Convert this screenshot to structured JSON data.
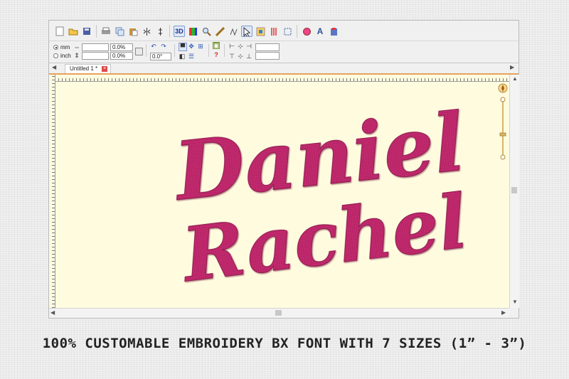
{
  "window": {
    "toolbar_icons": [
      "new-file-icon",
      "open-folder-icon",
      "save-icon",
      "print-icon",
      "copy-icon",
      "paste-icon",
      "mirror-horizontal-icon",
      "mirror-vertical-icon",
      "3d-view-icon",
      "color-view-icon",
      "zoom-icon",
      "measure-icon",
      "stitch-icon",
      "select-icon",
      "realistic-view-icon",
      "thread-icon",
      "transform-icon",
      "texture-icon",
      "lettering-icon",
      "font-icon",
      "settings-icon"
    ],
    "toolbar_labels": {
      "three_d": "3D",
      "lettering": "A"
    }
  },
  "properties": {
    "unit_mm": "mm",
    "unit_inch": "inch",
    "scale_x": "0.0%",
    "scale_y": "0.0%",
    "rotation": "0.0°"
  },
  "tabs": [
    {
      "label": "Untitled 1 *"
    }
  ],
  "design": {
    "line1": "Daniel",
    "line2": "Rachel",
    "thread_color": "#c2296e"
  },
  "caption": "100% CUSTOMABLE EMBROIDERY BX FONT WITH 7 SIZES (1” -  3”)"
}
